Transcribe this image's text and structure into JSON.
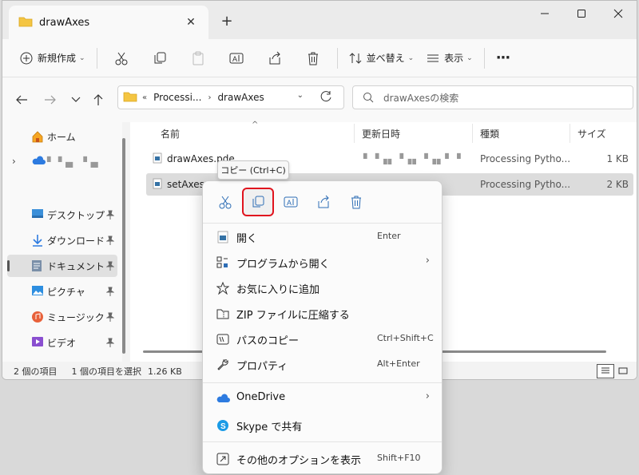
{
  "window": {
    "tab_title": "drawAxes",
    "close_glyph": "✕",
    "newtab_glyph": "+"
  },
  "toolbar": {
    "new_label": "新規作成",
    "sort_label": "並べ替え",
    "view_label": "表示",
    "more_glyph": "···"
  },
  "address": {
    "prefix": "«",
    "crumbs": [
      "Processi...",
      "drawAxes"
    ],
    "sep_glyph": "›",
    "search_placeholder": "drawAxesの検索"
  },
  "nav": {
    "items": [
      {
        "label": "ホーム"
      },
      {
        "label": "▘▝▗▖ ▝▗▖"
      },
      {
        "label": "デスクトップ"
      },
      {
        "label": "ダウンロード"
      },
      {
        "label": "ドキュメント"
      },
      {
        "label": "ピクチャ"
      },
      {
        "label": "ミュージック"
      },
      {
        "label": "ビデオ"
      }
    ],
    "pin_glyph": "📌"
  },
  "columns": {
    "name": "名前",
    "date": "更新日時",
    "type": "種類",
    "size": "サイズ",
    "sort_glyph": "^"
  },
  "files": [
    {
      "name": "drawAxes.pde",
      "date": "▘▝▗▖▝▗▖▝▗▖▘▝",
      "type": "Processing Pytho...",
      "size": "1 KB"
    },
    {
      "name": "setAxes.py",
      "date": "",
      "type": "Processing Pytho...",
      "size": "2 KB"
    }
  ],
  "status": {
    "count": "2 個の項目",
    "selected": "1 個の項目を選択",
    "size": "1.26 KB"
  },
  "tooltip": "コピー (Ctrl+C)",
  "context_menu": {
    "items": [
      {
        "label": "開く",
        "shortcut": "Enter"
      },
      {
        "label": "プログラムから開く",
        "arrow": "›"
      },
      {
        "label": "お気に入りに追加"
      },
      {
        "label": "ZIP ファイルに圧縮する"
      },
      {
        "label": "パスのコピー",
        "shortcut": "Ctrl+Shift+C"
      },
      {
        "label": "プロパティ",
        "shortcut": "Alt+Enter"
      },
      {
        "label": "OneDrive",
        "arrow": "›"
      },
      {
        "label": "Skype で共有"
      },
      {
        "label": "その他のオプションを表示",
        "shortcut": "Shift+F10"
      }
    ]
  },
  "colors": {
    "accent_highlight": "#e0141e",
    "folder": "#f4c542",
    "onedrive": "#2d7be0"
  }
}
